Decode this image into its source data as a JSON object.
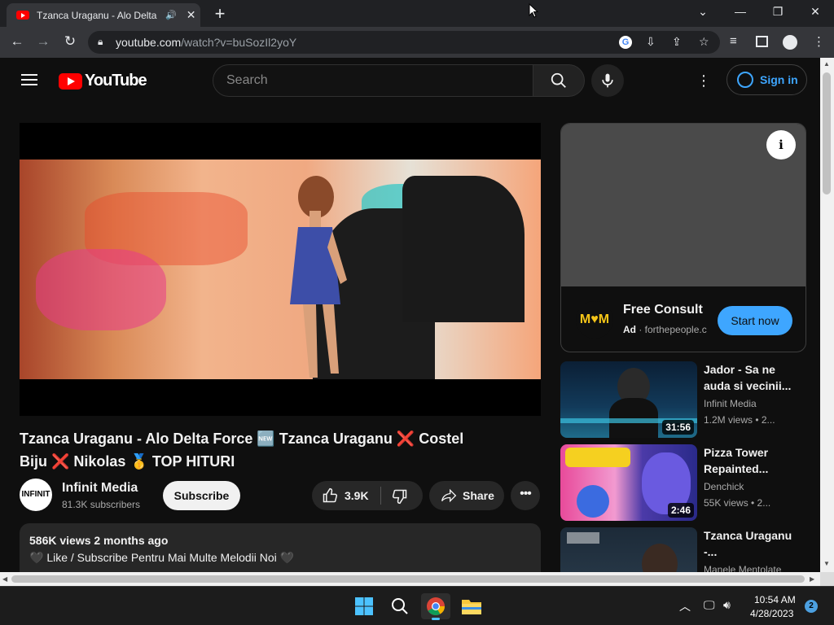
{
  "browser": {
    "tab_title": "Tzanca Uraganu - Alo Delta Force",
    "url_host": "youtube.com",
    "url_path": "/watch?v=buSozIl2yoY",
    "new_tab": "+",
    "tab_close": "✕"
  },
  "youtube": {
    "logo_text": "YouTube",
    "search_placeholder": "Search",
    "sign_in": "Sign in",
    "video": {
      "title": "Tzanca Uraganu - Alo Delta Force 🆕 Tzanca Uraganu ❌ Costel Biju ❌ Nikolas 🥇 TOP HITURI",
      "channel": "Infinit Media",
      "channel_avatar": "INFINIT",
      "subscribers": "81.3K subscribers",
      "subscribe": "Subscribe",
      "likes": "3.9K",
      "share": "Share",
      "views_age": "586K views  2 months ago",
      "description": "🖤 Like / Subscribe Pentru Mai Multe Melodii Noi 🖤"
    },
    "ad": {
      "logo": "M♥M",
      "title": "Free Consult",
      "label": "Ad",
      "domain": "forthepeople.c",
      "cta": "Start now",
      "info": "i"
    },
    "recommendations": [
      {
        "title": "Jador - Sa ne auda si vecinii...",
        "channel": "Infinit Media",
        "meta": "1.2M views  • 2...",
        "duration": "31:56"
      },
      {
        "title": "Pizza Tower Repainted...",
        "channel": "Denchick",
        "meta": "55K views  • 2...",
        "duration": "2:46"
      },
      {
        "title": "Tzanca Uraganu -...",
        "channel": "Manele Mentolate",
        "meta": "",
        "duration": ""
      }
    ]
  },
  "taskbar": {
    "time": "10:54 AM",
    "date": "4/28/2023",
    "notifications": "2"
  }
}
